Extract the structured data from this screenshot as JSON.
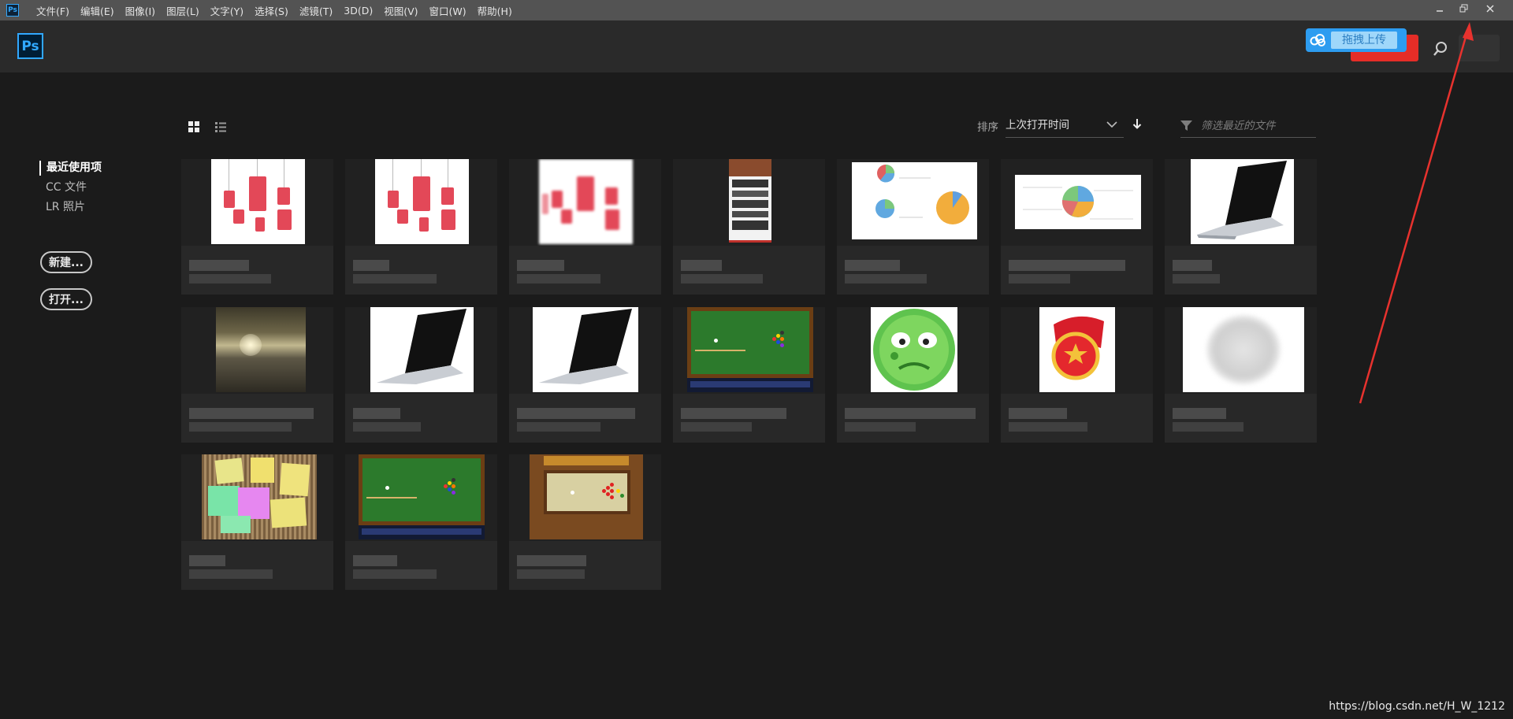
{
  "menubar": {
    "app_icon": "Ps",
    "items": [
      "文件(F)",
      "编辑(E)",
      "图像(I)",
      "图层(L)",
      "文字(Y)",
      "选择(S)",
      "滤镜(T)",
      "3D(D)",
      "视图(V)",
      "窗口(W)",
      "帮助(H)"
    ],
    "tooltip": "关闭"
  },
  "header": {
    "logo": "Ps",
    "upload_label": "拖拽上传",
    "icons": [
      "cloud-icon",
      "search-icon"
    ]
  },
  "nav": {
    "items": [
      "最近使用项",
      "CC 文件",
      "LR 照片"
    ],
    "new_button": "新建...",
    "open_button": "打开..."
  },
  "toolbar": {
    "sort_label": "排序",
    "sort_value": "上次打开时间",
    "filter_placeholder": "筛选最近的文件",
    "icons": [
      "grid-view-icon",
      "list-view-icon",
      "chevron-down-icon",
      "sort-direction-icon",
      "filter-icon"
    ]
  },
  "files": [
    {
      "thumb": "lanterns"
    },
    {
      "thumb": "lanterns"
    },
    {
      "thumb": "lanterns-blurred"
    },
    {
      "thumb": "web-page"
    },
    {
      "thumb": "pie-charts"
    },
    {
      "thumb": "pie-chart"
    },
    {
      "thumb": "laptop"
    },
    {
      "thumb": "sunset-lake"
    },
    {
      "thumb": "laptop"
    },
    {
      "thumb": "laptop"
    },
    {
      "thumb": "pool-table"
    },
    {
      "thumb": "green-face"
    },
    {
      "thumb": "youth-league-badge"
    },
    {
      "thumb": "blurred"
    },
    {
      "thumb": "sticky-notes"
    },
    {
      "thumb": "pool-table"
    },
    {
      "thumb": "snooker-table"
    }
  ],
  "watermark": "https://blog.csdn.net/H_W_1212",
  "colors": {
    "accent": "#31a8ff",
    "menubar": "#535353",
    "header": "#2a2a2a",
    "background": "#1b1b1b",
    "red_button": "#e52d27",
    "arrow": "#e8322e"
  }
}
